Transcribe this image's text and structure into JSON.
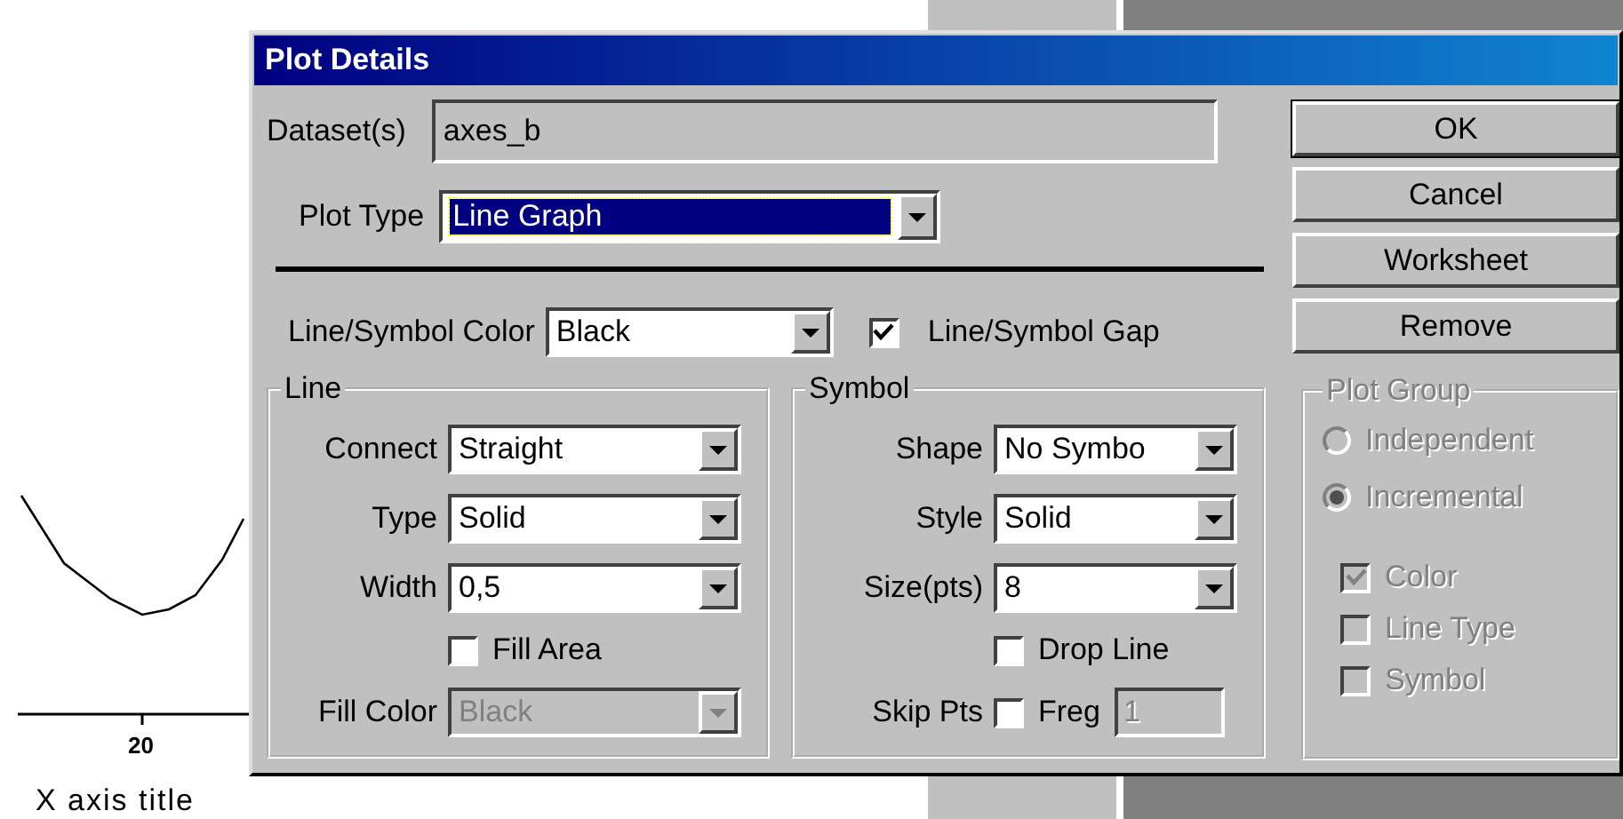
{
  "graph": {
    "tick_label": "20",
    "axis_title": "X axis title"
  },
  "window": {
    "title": "Plot Details"
  },
  "dataset": {
    "label": "Dataset(s)",
    "value": "axes_b"
  },
  "plot_type": {
    "label": "Plot Type",
    "value": "Line Graph",
    "highlighted": true
  },
  "line_symbol_color": {
    "label": "Line/Symbol Color",
    "value": "Black"
  },
  "line_symbol_gap": {
    "label": "Line/Symbol Gap",
    "checked": true
  },
  "line_group": {
    "title": "Line",
    "rows": [
      {
        "kind": "dropdown",
        "label": "Connect",
        "value": "Straight",
        "disabled": false
      },
      {
        "kind": "dropdown",
        "label": "Type",
        "value": "Solid",
        "disabled": false
      },
      {
        "kind": "dropdown",
        "label": "Width",
        "value": "0,5",
        "disabled": false
      },
      {
        "kind": "checkbox",
        "label": "Fill Area",
        "checked": false
      },
      {
        "kind": "dropdown",
        "label": "Fill Color",
        "value": "Black",
        "disabled": true
      }
    ]
  },
  "symbol_group": {
    "title": "Symbol",
    "rows": [
      {
        "kind": "dropdown",
        "label": "Shape",
        "value": "No Symbo",
        "disabled": false
      },
      {
        "kind": "dropdown",
        "label": "Style",
        "value": "Solid",
        "disabled": false
      },
      {
        "kind": "dropdown",
        "label": "Size(pts)",
        "value": "8",
        "disabled": false
      },
      {
        "kind": "checkbox",
        "label": "Drop Line",
        "checked": false
      },
      {
        "kind": "skip",
        "label": "Skip Pts",
        "check_label": "Freg",
        "checked": false,
        "value": "1",
        "disabled": true
      }
    ]
  },
  "buttons": [
    {
      "label": "OK",
      "default": true
    },
    {
      "label": "Cancel",
      "default": false
    },
    {
      "label": "Worksheet",
      "default": false
    },
    {
      "label": "Remove",
      "default": false
    }
  ],
  "plot_group": {
    "title": "Plot Group",
    "disabled": true,
    "radios": [
      {
        "label": "Independent",
        "selected": false
      },
      {
        "label": "Incremental",
        "selected": true
      }
    ],
    "checks": [
      {
        "label": "Color",
        "checked": true
      },
      {
        "label": "Line Type",
        "checked": false
      },
      {
        "label": "Symbol",
        "checked": false
      }
    ]
  }
}
